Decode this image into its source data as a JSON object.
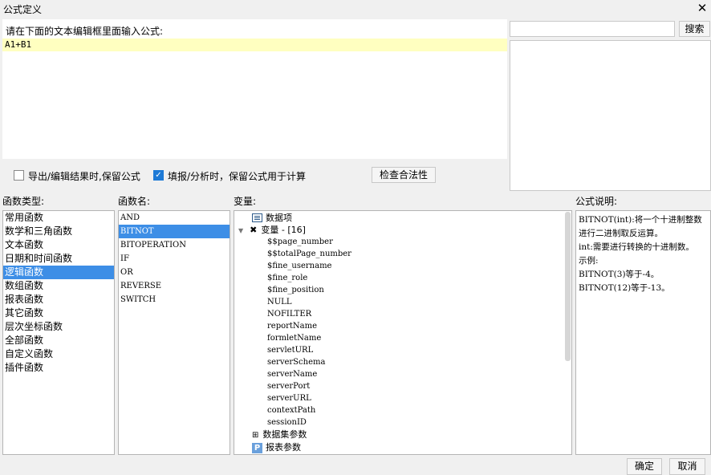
{
  "window": {
    "title": "公式定义"
  },
  "editor": {
    "label": "请在下面的文本编辑框里面输入公式:",
    "content": "A1+B1"
  },
  "search": {
    "button_label": "搜索",
    "value": ""
  },
  "options": {
    "preserve_export_label": "导出/编辑结果时,保留公式",
    "preserve_export_checked": false,
    "preserve_fill_label": "填报/分析时，保留公式用于计算",
    "preserve_fill_checked": true,
    "validate_label": "检查合法性"
  },
  "function_types": {
    "label": "函数类型:",
    "items": [
      "常用函数",
      "数学和三角函数",
      "文本函数",
      "日期和时间函数",
      "逻辑函数",
      "数组函数",
      "报表函数",
      "其它函数",
      "层次坐标函数",
      "全部函数",
      "自定义函数",
      "插件函数"
    ],
    "selected": "逻辑函数"
  },
  "function_names": {
    "label": "函数名:",
    "items": [
      "AND",
      "BITNOT",
      "BITOPERATION",
      "IF",
      "OR",
      "REVERSE",
      "SWITCH"
    ],
    "selected": "BITNOT"
  },
  "variables": {
    "label": "变量:",
    "data_items": "数据项",
    "variables_group": "变量 - [16]",
    "variable_items": [
      "$$page_number",
      "$$totalPage_number",
      "$fine_username",
      "$fine_role",
      "$fine_position",
      "NULL",
      "NOFILTER",
      "reportName",
      "formletName",
      "servletURL",
      "serverSchema",
      "serverName",
      "serverPort",
      "serverURL",
      "contextPath",
      "sessionID"
    ],
    "dataset_params": "数据集参数",
    "report_params": "报表参数"
  },
  "description": {
    "label": "公式说明:",
    "lines": [
      "BITNOT(int):将一个十进制整数进行二进制取反运算。",
      "int:需要进行转换的十进制数。",
      "示例:",
      "BITNOT(3)等于-4。",
      "BITNOT(12)等于-13。"
    ]
  },
  "footer": {
    "ok_label": "确定",
    "cancel_label": "取消"
  }
}
